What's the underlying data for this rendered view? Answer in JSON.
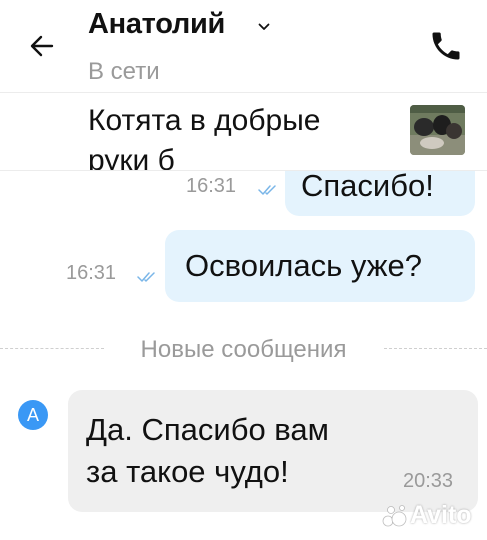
{
  "header": {
    "name": "Анатолий",
    "status": "В сети"
  },
  "listing": {
    "title": "Котята в добрые руки б"
  },
  "messages": [
    {
      "text": "Спасибо!",
      "time": "16:31",
      "direction": "outgoing",
      "read": true
    },
    {
      "text": "Освоилась уже?",
      "time": "16:31",
      "direction": "outgoing",
      "read": true
    },
    {
      "text_lines": [
        "Да. Спасибо вам",
        "за такое чудо!"
      ],
      "time": "20:33",
      "direction": "incoming"
    }
  ],
  "divider": {
    "label": "Новые сообщения"
  },
  "avatar": {
    "letter": "A",
    "color": "#3a98f5"
  },
  "watermark": {
    "text": "Avito"
  },
  "colors": {
    "outgoing_bubble": "#e4f3fd",
    "incoming_bubble": "#efefef",
    "read_check": "#7ab6e8",
    "muted_text": "#9a9a9a"
  },
  "icons": {
    "back": "arrow-left-icon",
    "caret": "chevron-down-icon",
    "phone": "phone-icon",
    "check": "double-check-icon"
  }
}
